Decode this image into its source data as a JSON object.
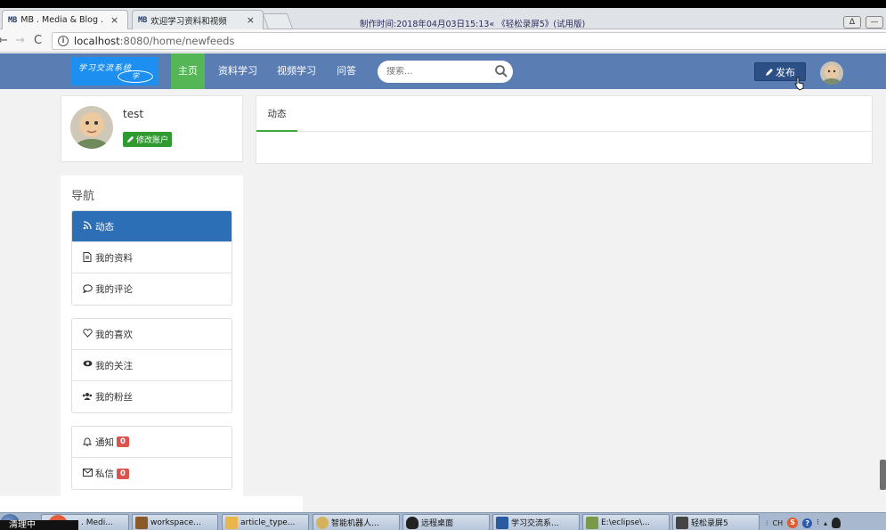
{
  "browser": {
    "tabs": [
      {
        "favicon": "MB",
        "label": "MB . Media & Blog . ",
        "close": "×"
      },
      {
        "favicon": "MB",
        "label": "欢迎学习资料和视频",
        "close": "×"
      }
    ],
    "recording_banner": "制作时间:2018年04月03日15:13« 《轻松录屏5》(试用版)",
    "url_host": "localhost",
    "url_path": ":8080/home/newfeeds"
  },
  "site": {
    "logo_line1": "学习交流系统",
    "logo_line2": "学",
    "nav_items": [
      "主页",
      "资料学习",
      "视频学习",
      "问答"
    ],
    "search_placeholder": "搜索...",
    "publish_label": "发布"
  },
  "profile": {
    "username": "test",
    "edit_label": "修改账户"
  },
  "feed": {
    "tab_label": "动态"
  },
  "sidebar": {
    "title": "导航",
    "group1": [
      {
        "icon": "rss-icon",
        "label": "动态"
      },
      {
        "icon": "document-icon",
        "label": "我的资料"
      },
      {
        "icon": "comment-icon",
        "label": "我的评论"
      }
    ],
    "group2": [
      {
        "icon": "heart-icon",
        "label": "我的喜欢"
      },
      {
        "icon": "eye-icon",
        "label": "我的关注"
      },
      {
        "icon": "users-icon",
        "label": "我的粉丝"
      }
    ],
    "group3": [
      {
        "icon": "bell-icon",
        "label": "通知",
        "badge": "0"
      },
      {
        "icon": "envelope-icon",
        "label": "私信",
        "badge": "0"
      }
    ]
  },
  "taskbar": {
    "ime_text": "清理中",
    "items": [
      ". Medi...",
      "workspace...",
      "article_type...",
      "智能机器人...",
      "远程桌面",
      "学习交流系...",
      "E:\\eclipse\\...",
      "轻松录屏5"
    ],
    "tray_lang": "CH"
  },
  "colors": {
    "site_nav": "#5a7db3",
    "active_nav": "#55b655",
    "active_sidebar": "#2c6fb7",
    "badge": "#d9534f",
    "edit_button": "#2e9a30"
  }
}
